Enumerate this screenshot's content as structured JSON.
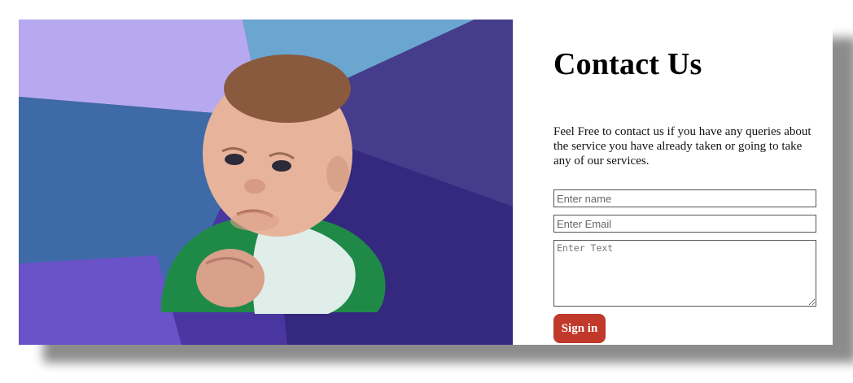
{
  "hero": {
    "icon": "success-kid-photo",
    "colors": {
      "lavender": "#b7a9f0",
      "skyblue": "#6aa6cf",
      "steel": "#3f6aa8",
      "violet": "#5e48b8",
      "indigo": "#3e2f86",
      "deep": "#2e2470"
    }
  },
  "contact": {
    "title": "Contact Us",
    "description": "Feel Free to contact us if you have any queries about the service you have already taken or going to take any of our services.",
    "name_placeholder": "Enter name",
    "email_placeholder": "Enter Email",
    "text_placeholder": "Enter Text",
    "submit_label": "Sign in"
  },
  "theme": {
    "button_color": "#c0392b"
  }
}
